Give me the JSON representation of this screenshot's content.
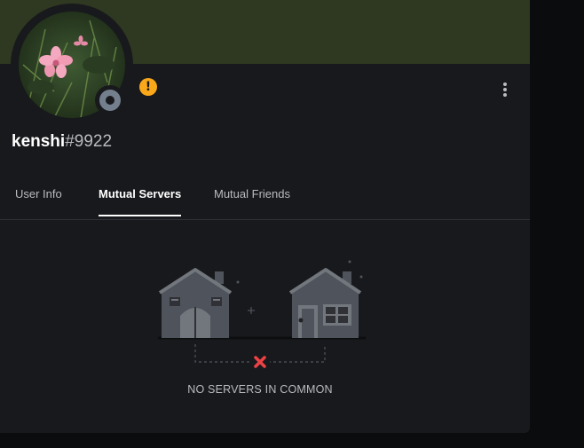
{
  "profile": {
    "username": "kenshi",
    "discriminator": "#9922",
    "warning_glyph": "!",
    "status": "offline",
    "banner_color": "#2f3820"
  },
  "tabs": [
    {
      "label": "User Info",
      "active": false
    },
    {
      "label": "Mutual Servers",
      "active": true
    },
    {
      "label": "Mutual Friends",
      "active": false
    }
  ],
  "empty_state": {
    "message": "NO SERVERS IN COMMON"
  }
}
